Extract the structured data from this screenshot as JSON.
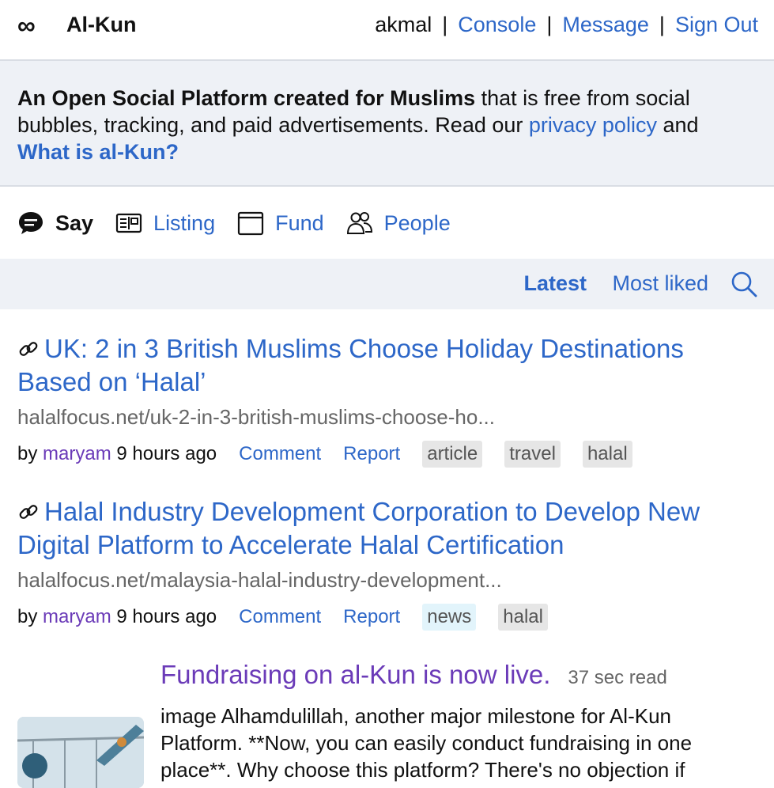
{
  "header": {
    "logo_icon": "infinity-icon",
    "title": "Al-Kun",
    "user": "akmal",
    "separator": "|",
    "console": "Console",
    "message": "Message",
    "signout": "Sign Out"
  },
  "banner": {
    "bold": "An Open Social Platform created for Muslims",
    "text1": " that is free from social bubbles, tracking, and paid advertisements. Read our ",
    "privacy_link": "privacy policy",
    "text2": " and ",
    "whatis_link": "What is al-Kun?"
  },
  "sections": [
    {
      "label": "Say",
      "icon": "speech-bubble-icon",
      "active": true
    },
    {
      "label": "Listing",
      "icon": "listing-icon",
      "active": false
    },
    {
      "label": "Fund",
      "icon": "wallet-icon",
      "active": false
    },
    {
      "label": "People",
      "icon": "people-icon",
      "active": false
    }
  ],
  "sort": {
    "latest": "Latest",
    "most_liked": "Most liked",
    "search_icon": "search-icon"
  },
  "posts": [
    {
      "title": "UK: 2 in 3 British Muslims Choose Holiday Destinations Based on ‘Halal’",
      "url": "halalfocus.net/uk-2-in-3-british-muslims-choose-ho...",
      "by": "by",
      "author": "maryam",
      "time": "9 hours ago",
      "comment": "Comment",
      "report": "Report",
      "tags": [
        "article",
        "travel",
        "halal"
      ]
    },
    {
      "title": "Halal Industry Development Corporation to Develop New Digital Platform to Accelerate Halal Certification",
      "url": "halalfocus.net/malaysia-halal-industry-development...",
      "by": "by",
      "author": "maryam",
      "time": "9 hours ago",
      "comment": "Comment",
      "report": "Report",
      "tags": [
        "news",
        "halal"
      ]
    }
  ],
  "article": {
    "title": "Fundraising on al-Kun is now live.",
    "readtime": "37 sec read",
    "body": "image Alhamdulillah, another major milestone for Al-Kun Platform. **Now, you can easily conduct fundraising in one place**. Why choose this platform? There's no objection if"
  },
  "colors": {
    "link": "#2d67c8",
    "author": "#6b3bb8",
    "banner_bg": "#eef1f6"
  }
}
